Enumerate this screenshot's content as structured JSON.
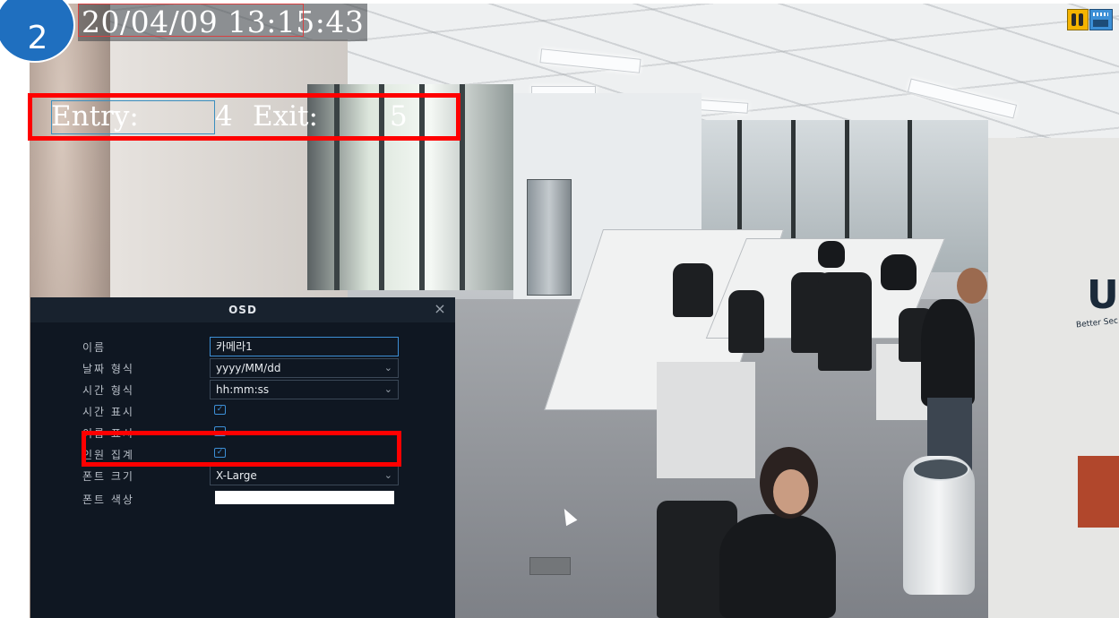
{
  "step_badge": "2",
  "camera_overlay": {
    "datetime": "20/04/09  13:15:43",
    "entry_label": "Entry:",
    "entry_value": "4",
    "exit_label": "Exit:",
    "exit_value": "5"
  },
  "osd_panel": {
    "title": "OSD",
    "close_icon": "close-icon",
    "rows": {
      "name": {
        "label": "이름",
        "value": "카메라1"
      },
      "date_format": {
        "label": "날짜 형식",
        "value": "yyyy/MM/dd"
      },
      "time_format": {
        "label": "시간 형식",
        "value": "hh:mm:ss"
      },
      "show_time": {
        "label": "시간 표시",
        "checked": true
      },
      "show_name": {
        "label": "이름 표시",
        "checked": false
      },
      "people_count": {
        "label": "인원 집계",
        "checked": true
      },
      "font_size": {
        "label": "폰트 크기",
        "value": "X-Large"
      },
      "font_color": {
        "label": "폰트 색상",
        "value": "#ffffff"
      }
    }
  },
  "colors": {
    "highlight": "#ff0000",
    "badge": "#1f6fbf",
    "panel_bg": "#0f1722",
    "accent": "#3d8fd6"
  },
  "status_icons": [
    "people-count-icon",
    "record-icon"
  ]
}
